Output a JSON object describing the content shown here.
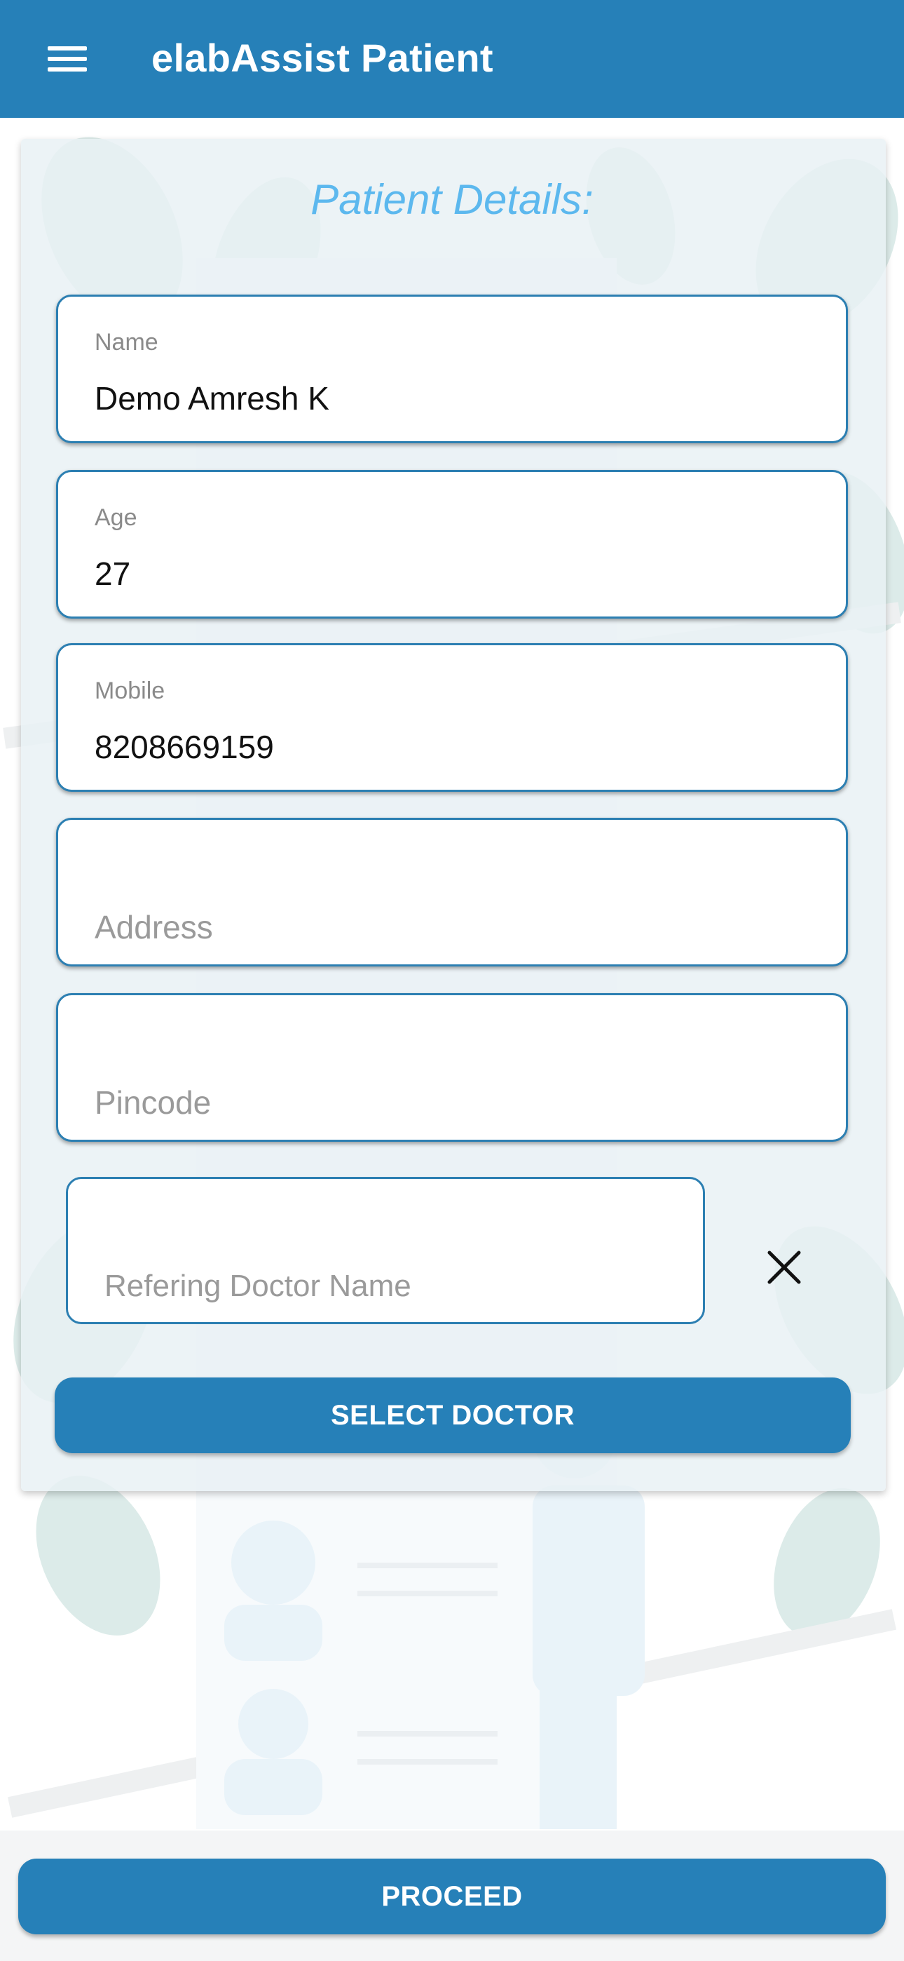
{
  "app_bar": {
    "title": "elabAssist Patient",
    "menu_icon": "menu-icon"
  },
  "form": {
    "title": "Patient Details:",
    "fields": [
      {
        "label": "Name",
        "value": "Demo Amresh K"
      },
      {
        "label": "Age",
        "value": "27"
      },
      {
        "label": "Mobile",
        "value": "8208669159"
      },
      {
        "placeholder": "Address"
      },
      {
        "placeholder": "Pincode"
      }
    ],
    "doctor": {
      "placeholder": "Refering Doctor Name",
      "clear_icon": "close-icon"
    },
    "select_doctor_label": "SELECT DOCTOR"
  },
  "proceed_label": "PROCEED",
  "colors": {
    "primary": "#2680b8",
    "title_accent": "#5cb8ee",
    "field_border": "#2c7fb2"
  }
}
